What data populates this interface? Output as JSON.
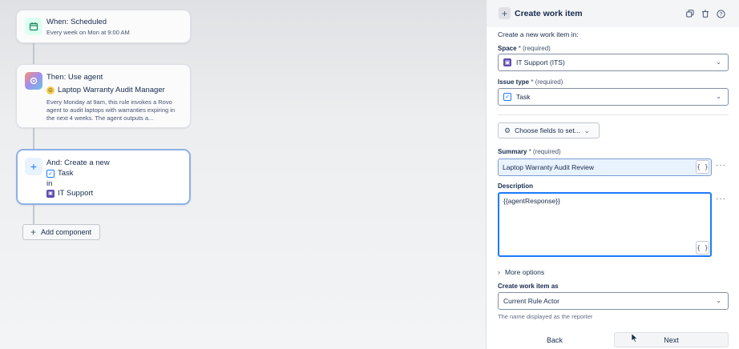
{
  "canvas": {
    "trigger": {
      "title": "When: Scheduled",
      "subtitle": "Every week on Mon at 9:00 AM",
      "icon": "calendar-icon"
    },
    "agent": {
      "title": "Then: Use agent",
      "agent_name": "Laptop Warranty Audit Manager",
      "description": "Every Monday at 9am, this rule invokes a Rovo agent to audit laptops with warranties expiring in the next 4 weeks. The agent outputs a...",
      "icon": "agent-icon"
    },
    "action": {
      "title": "And: Create a new",
      "type": "Task",
      "preposition": "in",
      "space": "IT Support",
      "icon": "plus-icon"
    },
    "add_component_label": "Add component"
  },
  "panel": {
    "title": "Create work item",
    "intro": "Create a new work item in:",
    "space": {
      "label": "Space",
      "required": " * (required)",
      "value": "IT Support (ITS)"
    },
    "issue_type": {
      "label": "Issue type",
      "required": " * (required)",
      "value": "Task"
    },
    "choose_fields_label": "Choose fields to set...",
    "summary": {
      "label": "Summary",
      "required": " * (required)",
      "value": "Laptop Warranty Audit Review"
    },
    "description": {
      "label": "Description",
      "value": "{{agentResponse}}"
    },
    "smart_value_label": "{ }",
    "more_label": "···",
    "more_options_label": "More options",
    "create_as": {
      "label": "Create work item as",
      "value": "Current Rule Actor",
      "help": "The name displayed as the reporter"
    },
    "back_label": "Back",
    "next_label": "Next"
  },
  "colors": {
    "accent": "#1d7afc",
    "selected_border": "#8fb1e5",
    "summary_bg": "#e9f2ff",
    "task_icon": "#1d7afc",
    "space_icon": "#5e4db2"
  }
}
